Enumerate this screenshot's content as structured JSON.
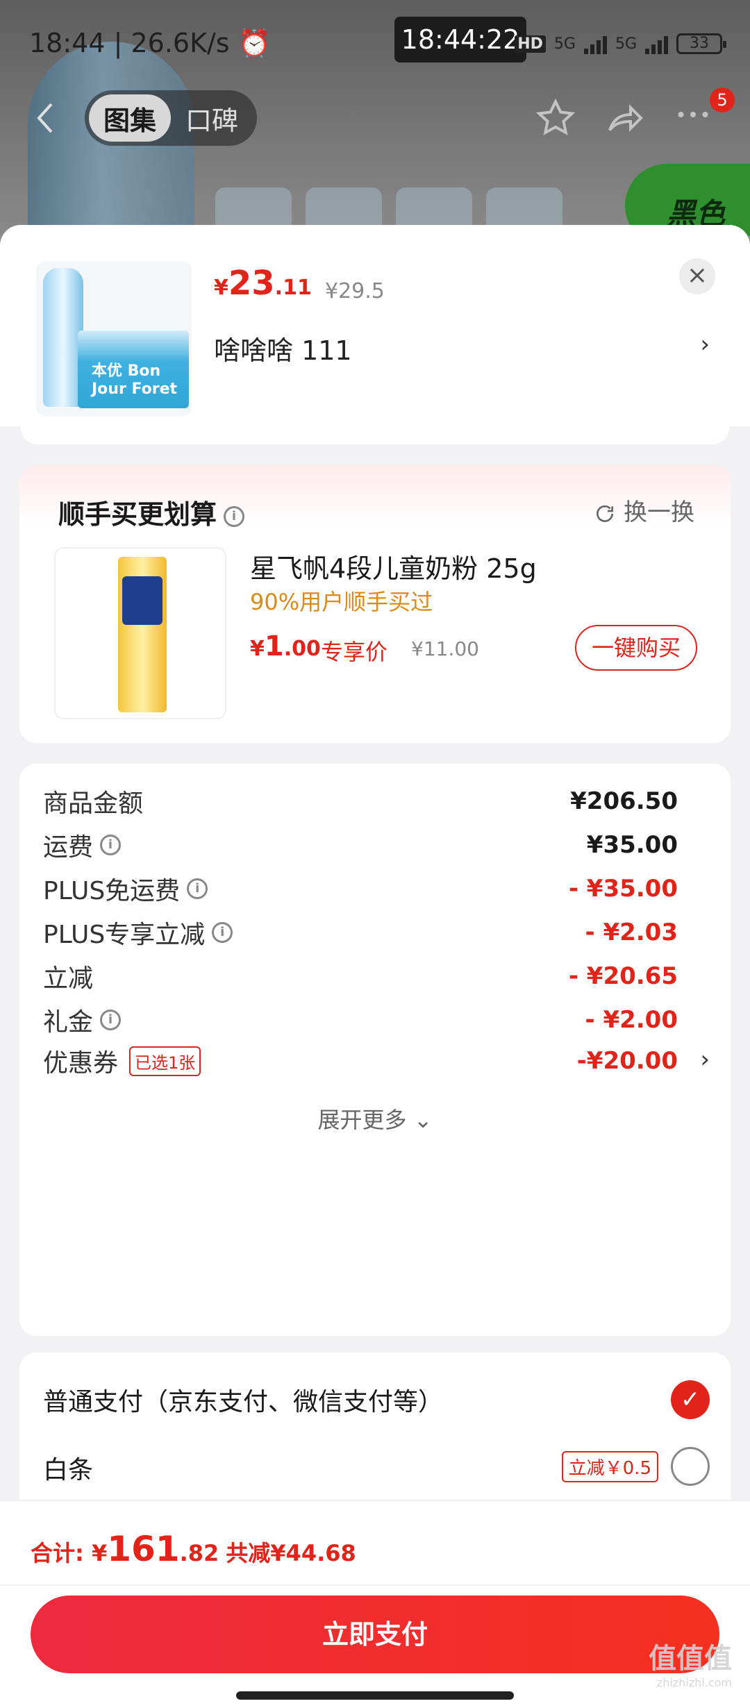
{
  "status_bar": {
    "left_text": "18:44 | 26.6K/s ⏰",
    "center_time": "18:44:22",
    "hd": "HD",
    "net1": "5G",
    "net2": "5G",
    "battery": "33"
  },
  "nav": {
    "back_icon": "chevron-left",
    "tabs": [
      {
        "label": "图集",
        "active": true
      },
      {
        "label": "口碑",
        "active": false
      }
    ],
    "star_icon": "star-outline",
    "share_icon": "share-arrow",
    "more_icon": "more-dots",
    "badge_count": "5",
    "bg_brand_text": "黑色"
  },
  "product": {
    "image_brand": "本优 Bon Jour Foret",
    "price_currency": "¥",
    "price_int": "23",
    "price_dec": ".11",
    "price_original": "¥29.5",
    "spec": "啥啥啥  111",
    "spec_chevron": "›",
    "close_label": "×"
  },
  "addon": {
    "title": "顺手买更划算",
    "info_icon": "i",
    "swap_label": "换一换",
    "swap_icon": "refresh-icon",
    "name": "星飞帆4段儿童奶粉 25g",
    "tag": "90%用户顺手买过",
    "price_currency": "¥",
    "price_int": "1",
    "price_dec": ".00",
    "exclusive_label": "专享价",
    "price_original": "¥11.00",
    "buy_label": "一键购买"
  },
  "amount": {
    "rows": [
      {
        "label": "商品金额",
        "value": "¥206.50",
        "info": false,
        "red": false
      },
      {
        "label": "运费",
        "value": "¥35.00",
        "info": true,
        "red": false
      },
      {
        "label": "PLUS免运费",
        "value": "- ¥35.00",
        "info": true,
        "red": true
      },
      {
        "label": "PLUS专享立减",
        "value": "- ¥2.03",
        "info": true,
        "red": true
      },
      {
        "label": "立减",
        "value": "- ¥20.65",
        "info": false,
        "red": true
      },
      {
        "label": "礼金",
        "value": "- ¥2.00",
        "info": true,
        "red": true
      }
    ],
    "coupon_label": "优惠券",
    "coupon_tag": "已选1张",
    "coupon_value": "-¥20.00",
    "coupon_chevron": "›",
    "expand_label": "展开更多",
    "expand_icon": "⌄"
  },
  "payment": {
    "normal_label": "普通支付（京东支付、微信支付等）",
    "normal_checked_icon": "✓",
    "baitiao_label": "白条",
    "baitiao_promo": "立减￥0.5"
  },
  "bottom": {
    "total_label": "合计: ",
    "total_currency": "¥",
    "total_int": "161",
    "total_dec": ".82",
    "saved": "共减¥44.68",
    "pay_button": "立即支付"
  },
  "watermark": {
    "text": "值值值",
    "sub": "zhizhizhi.com"
  },
  "colors": {
    "accent": "#e2231a",
    "addon_tag": "#d98a18",
    "sheet_bg": "#f2f2f4"
  }
}
